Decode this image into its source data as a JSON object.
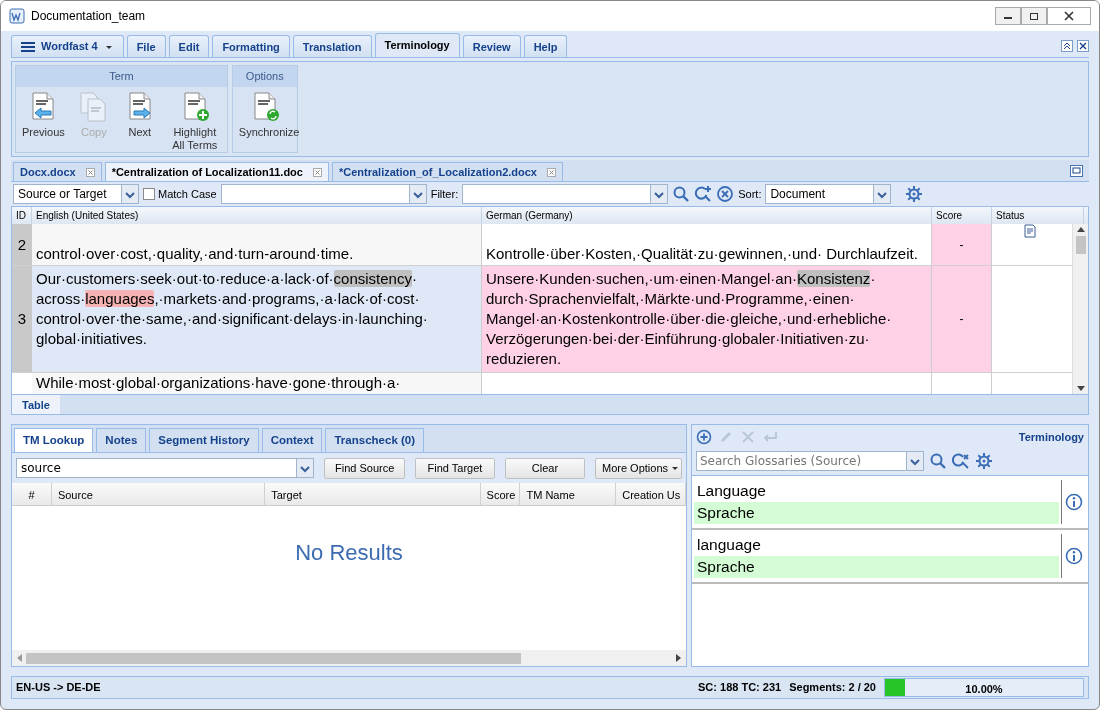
{
  "window": {
    "title": "Documentation_team"
  },
  "ribbon_tabs": [
    {
      "label": "Wordfast 4",
      "kind": "app",
      "selected": false
    },
    {
      "label": "File",
      "kind": "tab",
      "selected": false
    },
    {
      "label": "Edit",
      "kind": "tab",
      "selected": false
    },
    {
      "label": "Formatting",
      "kind": "tab",
      "selected": false
    },
    {
      "label": "Translation",
      "kind": "tab",
      "selected": false
    },
    {
      "label": "Terminology",
      "kind": "tab",
      "selected": true
    },
    {
      "label": "Review",
      "kind": "tab",
      "selected": false
    },
    {
      "label": "Help",
      "kind": "tab",
      "selected": false
    }
  ],
  "ribbon_groups": [
    {
      "title": "Term",
      "buttons": [
        {
          "label": "Previous",
          "kind": "prev",
          "disabled": false
        },
        {
          "label": "Copy",
          "kind": "copy",
          "disabled": true
        },
        {
          "label": "Next",
          "kind": "next",
          "disabled": false
        },
        {
          "label": "Highlight All Terms",
          "kind": "add",
          "disabled": false
        }
      ]
    },
    {
      "title": "Options",
      "buttons": [
        {
          "label": "Synchronize",
          "kind": "sync",
          "disabled": false
        }
      ]
    }
  ],
  "doc_tabs": [
    {
      "label": "Docx.docx",
      "selected": false
    },
    {
      "label": "*Centralization of Localization11.doc",
      "selected": true
    },
    {
      "label": "*Centralization_of_Localization2.docx",
      "selected": false
    }
  ],
  "filter_bar": {
    "scope": "Source or Target",
    "match_case_label": "Match Case",
    "match_case": false,
    "filter_label": "Filter:",
    "sort_label": "Sort:",
    "sort": "Document"
  },
  "table": {
    "columns": [
      "ID",
      "English (United States)",
      "German (Germany)",
      "Score",
      "Status"
    ],
    "rows": [
      {
        "id": "2",
        "selected": false,
        "source": [
          {
            "text": "control·over·cost,·quality,·and·turn-around·time."
          }
        ],
        "target": [
          {
            "text": "Kontrolle·über·Kosten,·Qualität·zu·gewinnen,·und· Durchlaufzeit."
          }
        ],
        "score": "-",
        "has_note": true
      },
      {
        "id": "3",
        "selected": true,
        "source": [
          {
            "text": "Our·customers·seek·out·to·reduce·a·lack·of·"
          },
          {
            "text": "consistency",
            "color": "#c0c0c0"
          },
          {
            "text": "· across·"
          },
          {
            "text": "languages",
            "color": "#f6b3b3"
          },
          {
            "text": ",·markets·and·programs,·a·lack·of·cost· control·over·the·same,·and·significant·delays·in·launching· global·initiatives."
          }
        ],
        "target": [
          {
            "text": "Unsere·Kunden·suchen,·um·einen·Mangel·an·"
          },
          {
            "text": "Konsistenz",
            "color": "#c0c0c0"
          },
          {
            "text": "· durch·Sprachenvielfalt,·Märkte·und·Programme,·einen· Mangel·an·Kostenkontrolle·über·die·gleiche,·und·erhebliche· Verzögerungen·bei·der·Einführung·globaler·Initiativen·zu· reduzieren."
          }
        ],
        "score": "-",
        "has_note": false
      },
      {
        "id": "",
        "selected": false,
        "source": [
          {
            "text": "While·most·global·organizations·have·gone·through·a·"
          }
        ],
        "target": [],
        "score": "",
        "has_note": false
      }
    ]
  },
  "view_tabs": [
    {
      "label": "Table",
      "selected": true
    }
  ],
  "lookup_tabs": [
    {
      "label": "TM Lookup",
      "selected": true
    },
    {
      "label": "Notes",
      "selected": false
    },
    {
      "label": "Segment History",
      "selected": false
    },
    {
      "label": "Context",
      "selected": false
    },
    {
      "label": "Transcheck (0)",
      "selected": false
    }
  ],
  "lookup": {
    "query": "source",
    "buttons": [
      "Find Source",
      "Find Target",
      "Clear"
    ],
    "more_button": "More Options",
    "columns": [
      "#",
      "Source",
      "Target",
      "Score",
      "TM Name",
      "Creation Us"
    ],
    "empty_text": "No Results"
  },
  "terminology": {
    "title": "Terminology",
    "tools": [
      {
        "kind": "add",
        "disabled": false
      },
      {
        "kind": "edit",
        "disabled": true
      },
      {
        "kind": "delete",
        "disabled": true
      },
      {
        "kind": "enter",
        "disabled": true
      }
    ],
    "search_placeholder": "Search Glossaries (Source)",
    "entries": [
      {
        "source": "Language",
        "target": "Sprache"
      },
      {
        "source": "language",
        "target": "Sprache"
      }
    ]
  },
  "status_bar": {
    "locale": "EN-US -> DE-DE",
    "counts": "SC: 188 TC: 231",
    "segments": "Segments: 2 / 20",
    "progress": "10.00%",
    "level": 0.1
  }
}
